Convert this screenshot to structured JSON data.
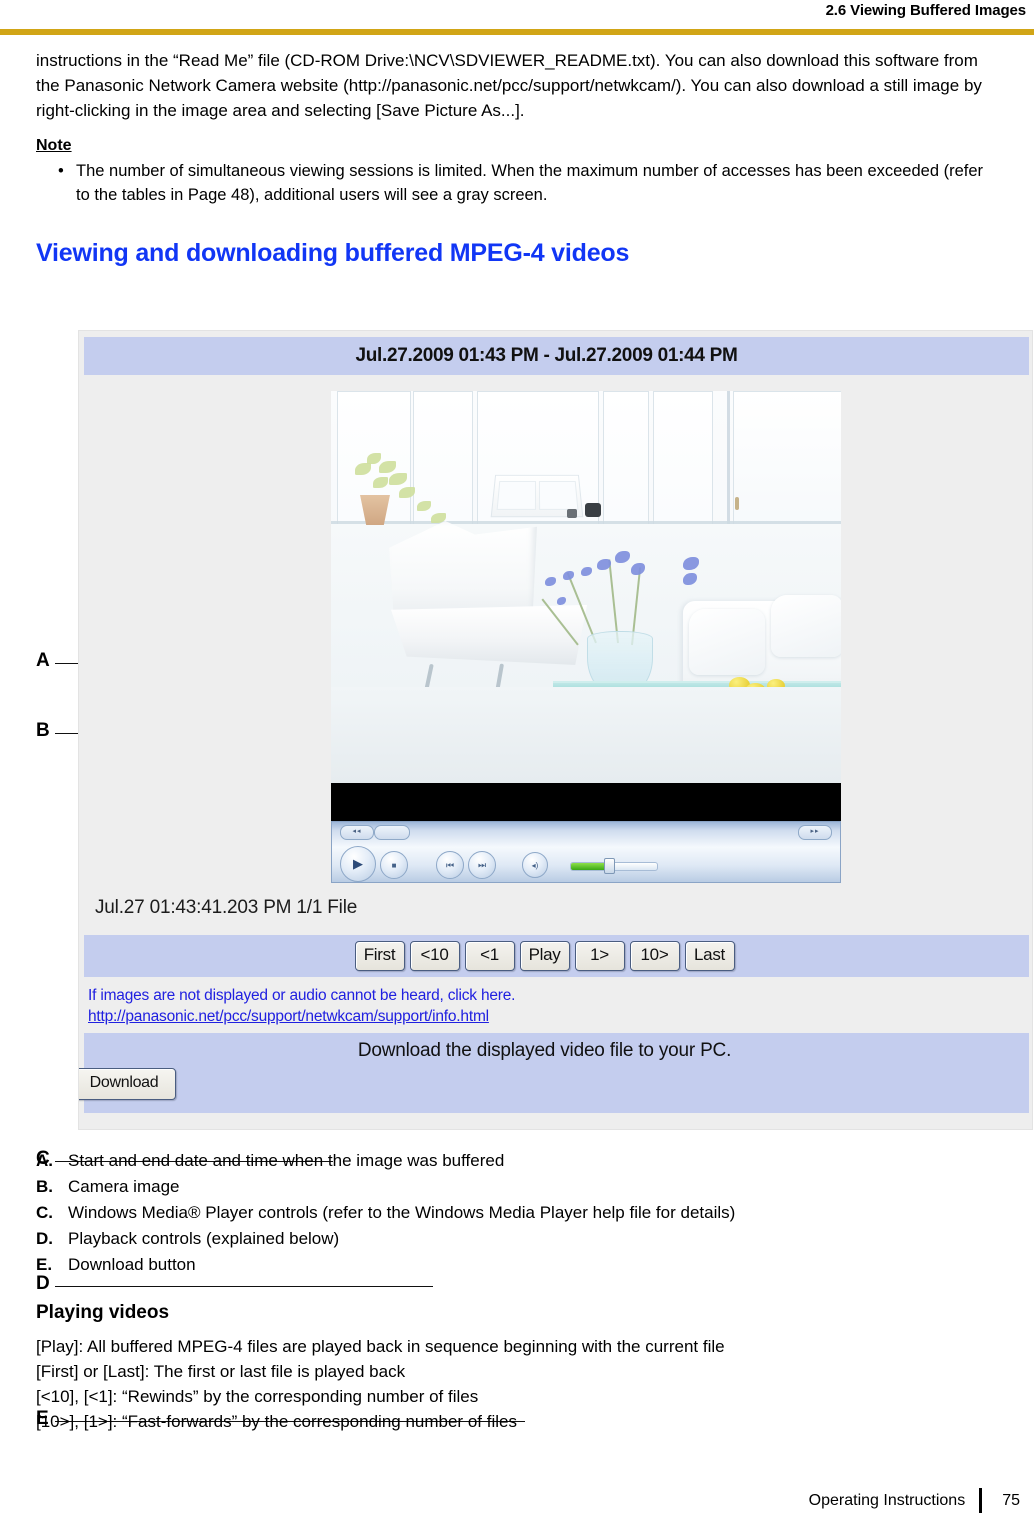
{
  "header": {
    "running_head": "2.6 Viewing Buffered Images",
    "rule_color": "#d1a516"
  },
  "body": {
    "paragraph_1": "instructions in the “Read Me” file (CD-ROM Drive:\\NCV\\SDVIEWER_README.txt). You can also download this software from the Panasonic Network Camera website (http://panasonic.net/pcc/support/netwkcam/). You can also download a still image by right-clicking in the image area and selecting [Save Picture As...].",
    "note_heading": "Note",
    "note_bullet_char": "•",
    "note_items": [
      "The number of simultaneous viewing sessions is limited. When the maximum number of accesses has been exceeded (refer to the tables in Page 48), additional users will see a gray screen."
    ]
  },
  "section": {
    "title": "Viewing and downloading buffered MPEG-4 videos",
    "title_color": "#1136f5"
  },
  "figure": {
    "callouts": [
      "A",
      "B",
      "C",
      "D",
      "E"
    ],
    "titlebar": {
      "timestamp_range": "Jul.27.2009 01:43 PM - Jul.27.2009 01:44 PM",
      "bg_color": "#c4cdee"
    },
    "camera_image": {
      "alt": "camera image of a white interior room with chair, table and sofa"
    },
    "wmp_controls": {
      "tab_left_label": "◂◂",
      "tab_right_label": "▸▸",
      "play_glyph": "▶",
      "stop_glyph": "■",
      "prev_glyph": "⏮",
      "next_glyph": "⏭",
      "mute_glyph": "◂)"
    },
    "file_time": "Jul.27 01:43:41.203 PM   1/1 File",
    "playback_buttons": [
      "First",
      "<10",
      "<1",
      "Play",
      "1>",
      "10>",
      "Last"
    ],
    "link_block": {
      "line_1": "If images are not displayed or audio cannot be heard, click here.",
      "line_2": "http://panasonic.net/pcc/support/netwkcam/support/info.html",
      "link_color": "#2020e0"
    },
    "download_block": {
      "text": "Download the displayed video file to your PC.",
      "button_label": "Download",
      "bg_color": "#c4cdee"
    }
  },
  "legend": [
    {
      "key": "A.",
      "text": "Start and end date and time when the image was buffered"
    },
    {
      "key": "B.",
      "text": "Camera image"
    },
    {
      "key": "C.",
      "text": "Windows Media® Player controls (refer to the Windows Media Player help file for details)"
    },
    {
      "key": "D.",
      "text": "Playback controls (explained below)"
    },
    {
      "key": "E.",
      "text": "Download button"
    }
  ],
  "playing_videos": {
    "heading": "Playing videos",
    "lines": [
      "[Play]: All buffered MPEG-4 files are played back in sequence beginning with the current file",
      "[First] or [Last]: The first or last file is played back",
      "[<10], [<1]: “Rewinds” by the corresponding number of files",
      "[10>], [1>]: “Fast-forwards” by the corresponding number of files"
    ]
  },
  "footer": {
    "label": "Operating Instructions",
    "page_number": "75"
  }
}
